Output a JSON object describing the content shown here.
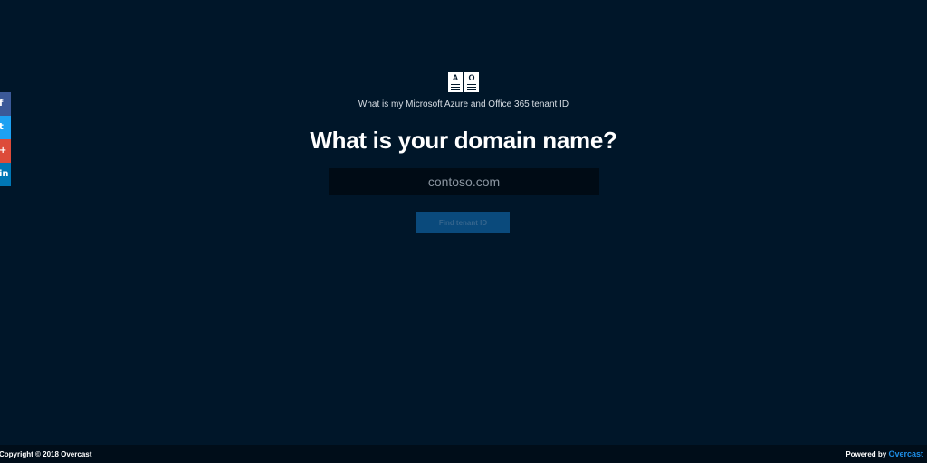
{
  "share": {
    "facebook_glyph": "f",
    "twitter_glyph": "t",
    "google_glyph": "+",
    "linkedin_glyph": "in"
  },
  "logos": {
    "azure_glyph": "A",
    "office_glyph": "O"
  },
  "subtitle": "What is my Microsoft Azure and Office 365 tenant ID",
  "heading": "What is your domain name?",
  "domain_input": {
    "value": "",
    "placeholder": "contoso.com"
  },
  "find_button_label": "Find tenant ID",
  "footer": {
    "copyright": "Copyright © 2018 Overcast",
    "powered_prefix": "Powered by ",
    "powered_link": "Overcast"
  },
  "colors": {
    "background": "#001629",
    "footer_background": "#000d19",
    "input_background": "#000b15",
    "button_background": "#0a4a7c",
    "link_accent": "#1e8fe8",
    "facebook": "#3b5998",
    "twitter": "#1da1f2",
    "google": "#dd4b39",
    "linkedin": "#0077b5"
  }
}
